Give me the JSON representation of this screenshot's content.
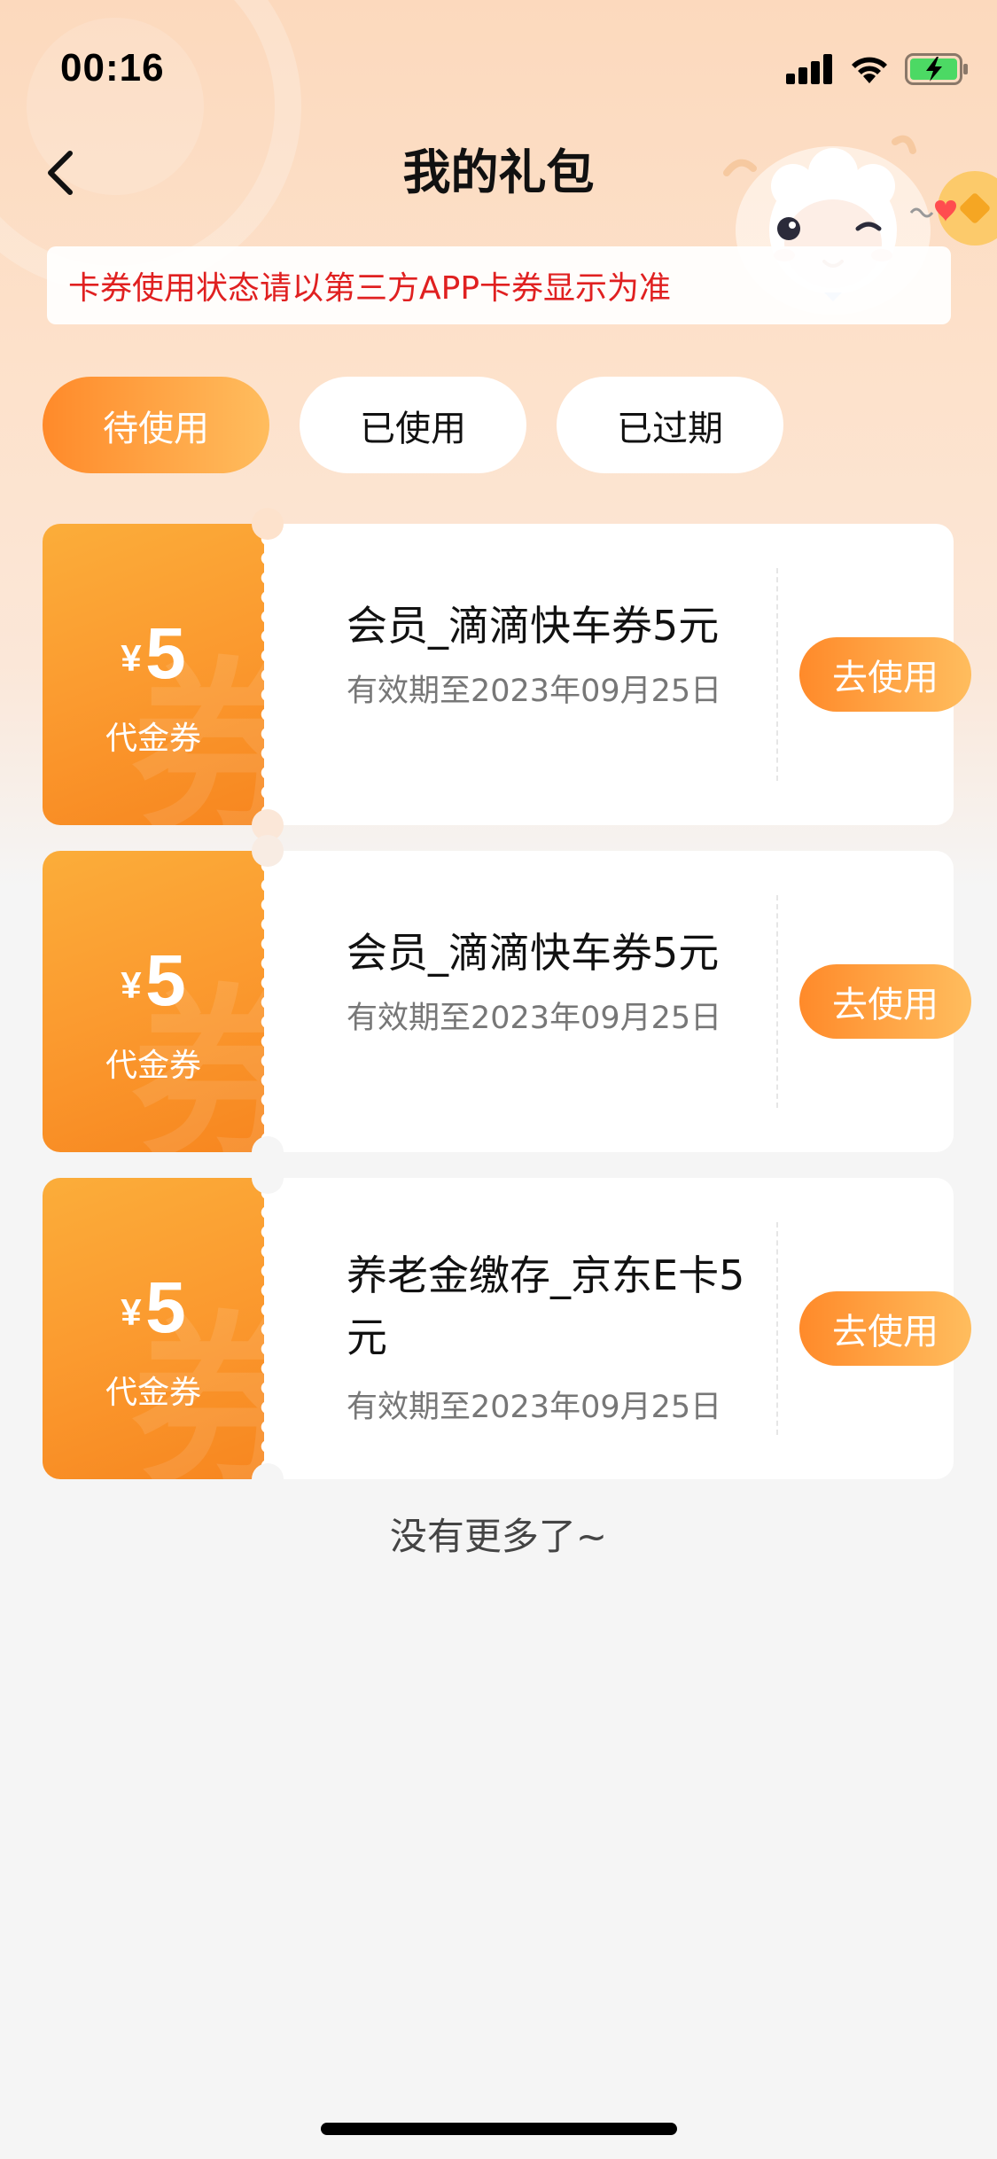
{
  "status_bar": {
    "time": "00:16"
  },
  "nav": {
    "title": "我的礼包"
  },
  "notice": {
    "text": "卡券使用状态请以第三方APP卡券显示为准"
  },
  "tabs": [
    {
      "label": "待使用",
      "active": true
    },
    {
      "label": "已使用",
      "active": false
    },
    {
      "label": "已过期",
      "active": false
    }
  ],
  "coupons": [
    {
      "currency": "¥",
      "amount": "5",
      "type_label": "代金券",
      "watermark": "券",
      "title": "会员_滴滴快车券5元",
      "expiry": "有效期至2023年09月25日",
      "button": "去使用"
    },
    {
      "currency": "¥",
      "amount": "5",
      "type_label": "代金券",
      "watermark": "券",
      "title": "会员_滴滴快车券5元",
      "expiry": "有效期至2023年09月25日",
      "button": "去使用"
    },
    {
      "currency": "¥",
      "amount": "5",
      "type_label": "代金券",
      "watermark": "券",
      "title": "养老金缴存_京东E卡5元",
      "expiry": "有效期至2023年09月25日",
      "button": "去使用"
    }
  ],
  "footer": {
    "no_more": "没有更多了~"
  },
  "colors": {
    "accent_start": "#ff8a2a",
    "accent_end": "#ffbd5e",
    "notice_text": "#e02020",
    "battery": "#4cd964"
  },
  "icons": [
    "signal-icon",
    "wifi-icon",
    "battery-charging-icon",
    "back-arrow-icon",
    "mascot-sheep-icon"
  ]
}
